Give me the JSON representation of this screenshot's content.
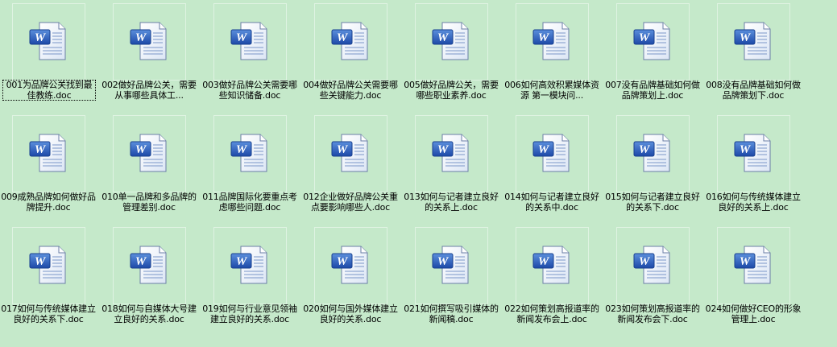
{
  "window": {
    "background": "#c5e9ca"
  },
  "files": [
    {
      "name": "001为品牌公关找到最佳教练.doc",
      "icon": "word-document-icon"
    },
    {
      "name": "002做好品牌公关，需要从事哪些具体工...",
      "icon": "word-document-icon"
    },
    {
      "name": "003做好品牌公关需要哪些知识储备.doc",
      "icon": "word-document-icon"
    },
    {
      "name": "004做好品牌公关需要哪些关键能力.doc",
      "icon": "word-document-icon"
    },
    {
      "name": "005做好品牌公关，需要哪些职业素养.doc",
      "icon": "word-document-icon"
    },
    {
      "name": "006如何高效积累媒体资源 第一模块问...",
      "icon": "word-document-icon"
    },
    {
      "name": "007没有品牌基础如何做品牌策划上.doc",
      "icon": "word-document-icon"
    },
    {
      "name": "008没有品牌基础如何做品牌策划下.doc",
      "icon": "word-document-icon"
    },
    {
      "name": "009成熟品牌如何做好品牌提升.doc",
      "icon": "word-document-icon"
    },
    {
      "name": "010单一品牌和多品牌的管理差别.doc",
      "icon": "word-document-icon"
    },
    {
      "name": "011品牌国际化要重点考虑哪些问题.doc",
      "icon": "word-document-icon"
    },
    {
      "name": "012企业做好品牌公关重点要影响哪些人.doc",
      "icon": "word-document-icon"
    },
    {
      "name": "013如何与记者建立良好的关系上.doc",
      "icon": "word-document-icon"
    },
    {
      "name": "014如何与记者建立良好的关系中.doc",
      "icon": "word-document-icon"
    },
    {
      "name": "015如何与记者建立良好的关系下.doc",
      "icon": "word-document-icon"
    },
    {
      "name": "016如何与传统媒体建立良好的关系上.doc",
      "icon": "word-document-icon"
    },
    {
      "name": "017如何与传统媒体建立良好的关系下.doc",
      "icon": "word-document-icon"
    },
    {
      "name": "018如何与自媒体大号建立良好的关系.doc",
      "icon": "word-document-icon"
    },
    {
      "name": "019如何与行业意见领袖建立良好的关系.doc",
      "icon": "word-document-icon"
    },
    {
      "name": "020如何与国外媒体建立良好的关系.doc",
      "icon": "word-document-icon"
    },
    {
      "name": "021如何撰写吸引媒体的新闻稿.doc",
      "icon": "word-document-icon"
    },
    {
      "name": "022如何策划高报道率的新闻发布会上.doc",
      "icon": "word-document-icon"
    },
    {
      "name": "023如何策划高报道率的新闻发布会下.doc",
      "icon": "word-document-icon"
    },
    {
      "name": "024如何做好CEO的形象管理上.doc",
      "icon": "word-document-icon"
    }
  ]
}
